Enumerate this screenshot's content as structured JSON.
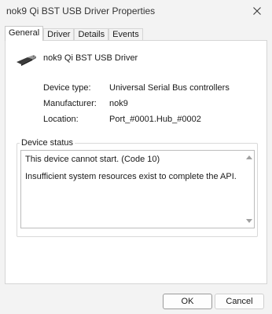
{
  "window": {
    "title": "nok9 Qi BST USB Driver Properties"
  },
  "tabs": [
    {
      "label": "General",
      "active": true
    },
    {
      "label": "Driver",
      "active": false
    },
    {
      "label": "Details",
      "active": false
    },
    {
      "label": "Events",
      "active": false
    }
  ],
  "device": {
    "name": "nok9 Qi BST USB Driver",
    "icon": "usb-connector-icon",
    "properties": [
      {
        "label": "Device type:",
        "value": "Universal Serial Bus controllers"
      },
      {
        "label": "Manufacturer:",
        "value": "nok9"
      },
      {
        "label": "Location:",
        "value": "Port_#0001.Hub_#0002"
      }
    ]
  },
  "status": {
    "group_label": "Device status",
    "line1": "This device cannot start. (Code 10)",
    "line2": "Insufficient system resources exist to complete the API."
  },
  "buttons": {
    "ok": "OK",
    "cancel": "Cancel"
  }
}
